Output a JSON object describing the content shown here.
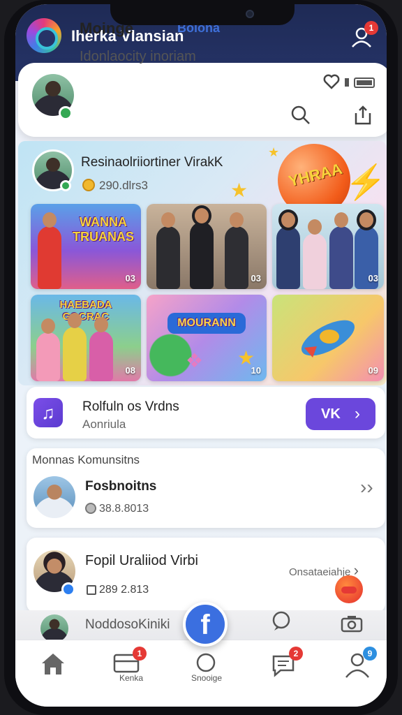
{
  "header": {
    "app_title": "Iherka Vlansian",
    "notification_count": "1"
  },
  "profile": {
    "name": "Moinge",
    "tag": "Bolona",
    "subtitle": "Idonlaocity inoriam"
  },
  "hero": {
    "title": "Resinaolriiortiner VirakK",
    "count": "290.dlrs3",
    "balloon_text": "YHRAA",
    "tiles": [
      {
        "label": "WANNA TRUANAS",
        "count": "03"
      },
      {
        "label": "",
        "count": "03"
      },
      {
        "label": "",
        "count": "03"
      },
      {
        "label": "HAEBADA GOCRAC",
        "count": "08"
      },
      {
        "label": "MOURANN",
        "count": "10"
      },
      {
        "label": "",
        "count": "09"
      }
    ]
  },
  "music": {
    "title": "Rolfuln os Vrdns",
    "subtitle": "Aonriula",
    "button_label": "VK",
    "button_arrow": "›"
  },
  "community": {
    "header": "Monnas Komunsitns",
    "name": "Fosbnoitns",
    "meta": "38.8.8013",
    "chevron": "››"
  },
  "post": {
    "title": "Fopil Uraliiod Virbi",
    "meta": "289 2.813",
    "action": "Onsataeiahje",
    "chevron": "›"
  },
  "partial_row": {
    "name": "NoddosoKiniki"
  },
  "fb_button": {
    "label": "f"
  },
  "bottom_nav": {
    "items": [
      {
        "label": ""
      },
      {
        "label": "Kenka",
        "badge": "1"
      },
      {
        "label": "Snooige"
      },
      {
        "label": "",
        "badge": "2"
      },
      {
        "label": "",
        "badge": "9"
      }
    ]
  },
  "colors": {
    "header_bg": "#263468",
    "accent_purple": "#6b47dc",
    "fb_blue": "#3b6fe0",
    "badge_red": "#e53935"
  }
}
